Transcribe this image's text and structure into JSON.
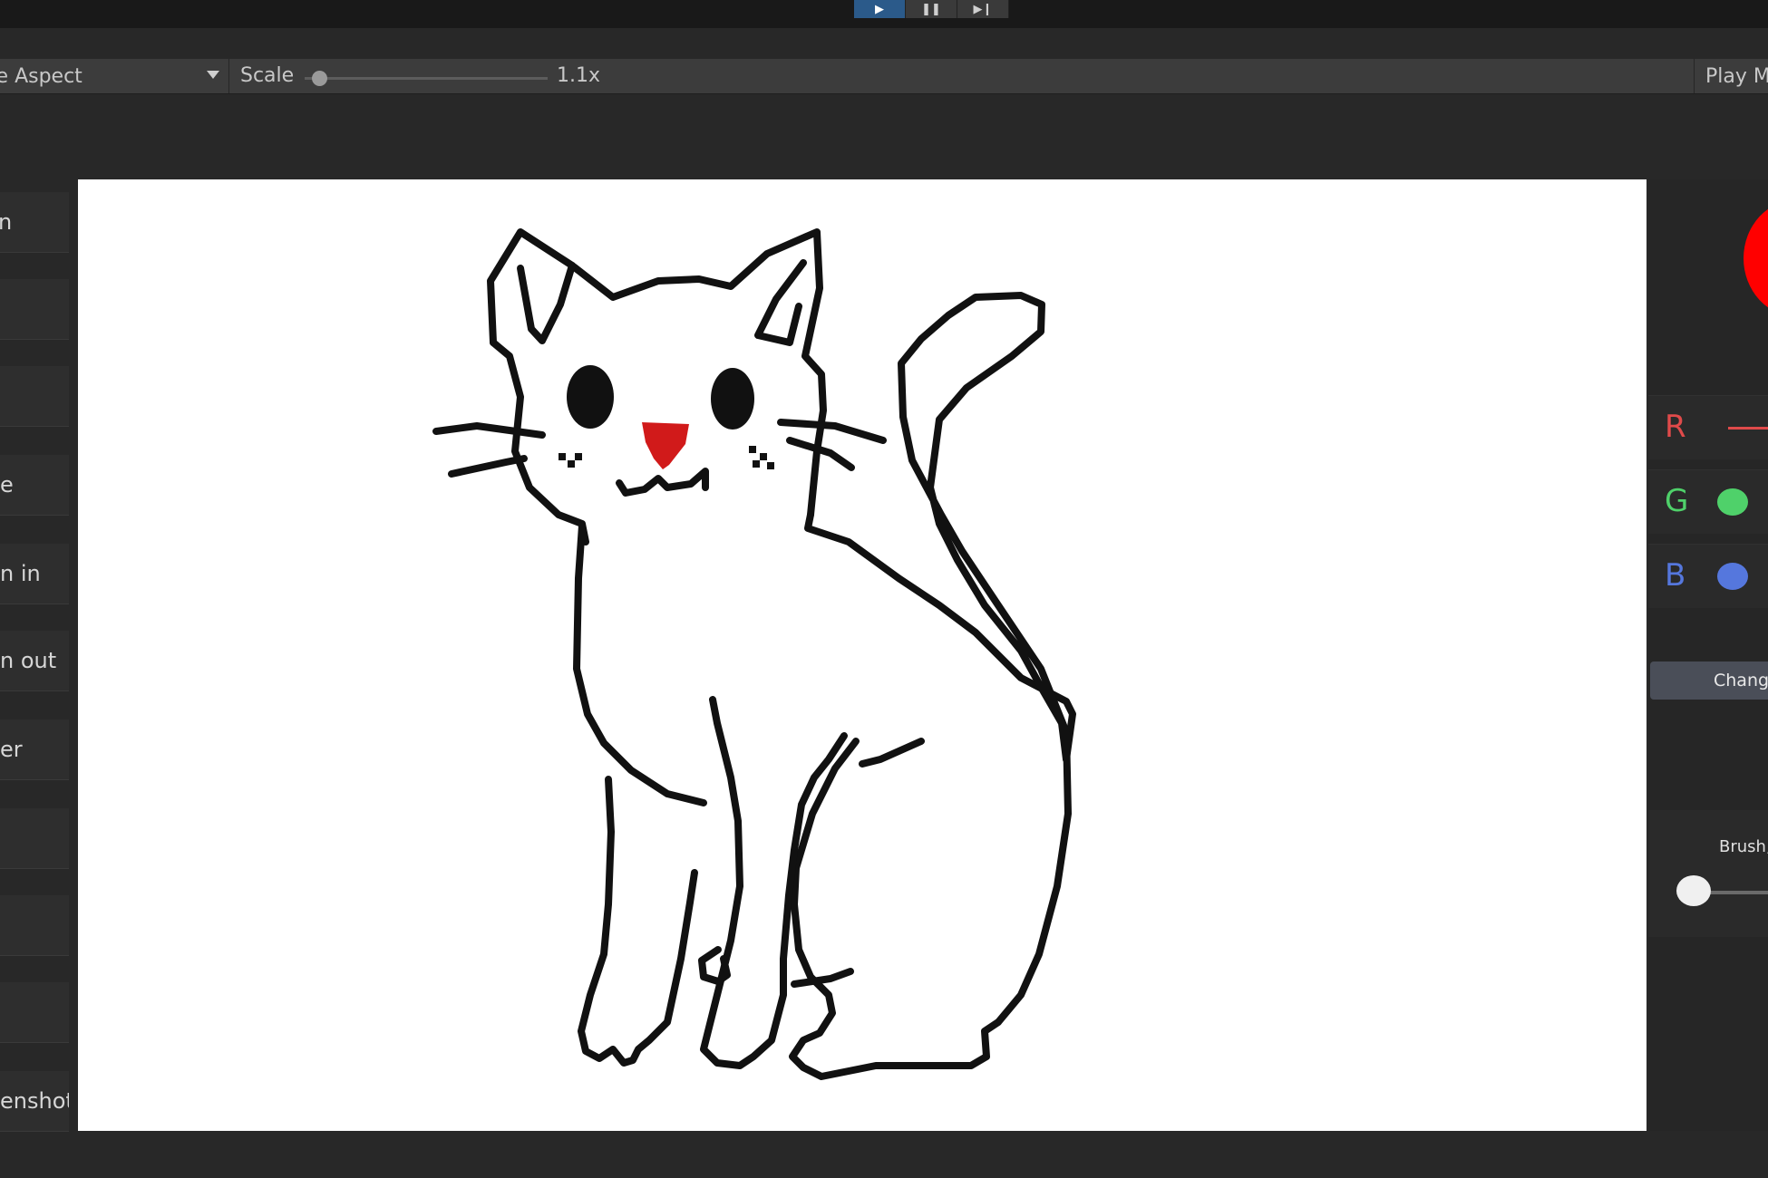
{
  "playbar": {
    "play_icon": "play-icon",
    "pause_icon": "pause-icon",
    "step_icon": "step-icon"
  },
  "gameview_toolbar": {
    "aspect_label": "ee Aspect",
    "scale_label": "Scale",
    "scale_value": "1.1x",
    "playmode_label": "Play M"
  },
  "sidebar": {
    "buttons": [
      {
        "label": "n"
      },
      {
        "label": ""
      },
      {
        "label": ""
      },
      {
        "label": "e"
      },
      {
        "label": "n in"
      },
      {
        "label": "n out"
      },
      {
        "label": "er"
      },
      {
        "label": ""
      },
      {
        "label": ""
      },
      {
        "label": ""
      },
      {
        "label": "enshot"
      }
    ]
  },
  "color_panel": {
    "current_color": "#ff0000",
    "r_label": "R",
    "g_label": "G",
    "b_label": "B",
    "r_color": "#e04a4a",
    "g_color": "#4fd16a",
    "b_color": "#5577dd",
    "change_button": "Chang",
    "brush_label": "Brush,"
  },
  "canvas": {
    "subject": "cat drawing",
    "stroke_color": "#111111",
    "nose_color": "#d11a1a"
  }
}
